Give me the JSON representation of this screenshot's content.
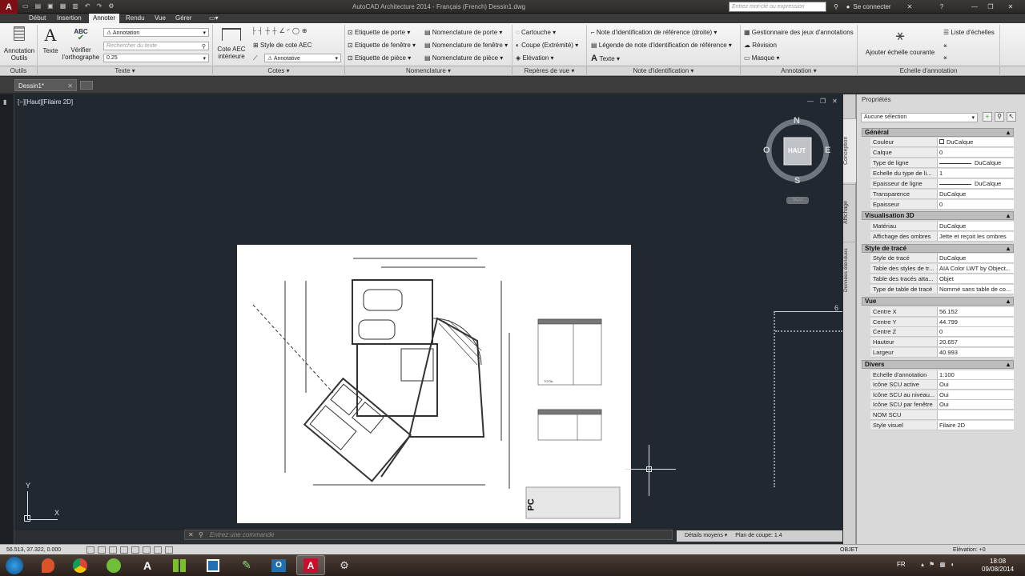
{
  "window": {
    "title": "AutoCAD Architecture 2014 - Français (French)    Dessin1.dwg",
    "search_placeholder": "Entrez mot-clé ou expression",
    "sign_in": "Se connecter"
  },
  "menu_tabs": [
    "Début",
    "Insertion",
    "Annoter",
    "Rendu",
    "Vue",
    "Gérer"
  ],
  "active_tab": "Annoter",
  "ribbon": {
    "outils": {
      "btn1_line1": "Annotation",
      "btn1_line2": "Outils",
      "panel": "Outils"
    },
    "texte": {
      "texte_btn": "Texte",
      "spell_top": "ABC",
      "spell_line1": "Vérifier",
      "spell_line2": "l'orthographe",
      "style_value": "Annotation",
      "search_placeholder": "Rechercher du texte",
      "height_value": "0.25",
      "panel": "Texte"
    },
    "cotes": {
      "cote_aec_line1": "Cote AEC",
      "cote_aec_line2": "intérieure",
      "style_label": "Style de cote AEC",
      "annotative": "Annotative",
      "panel": "Cotes"
    },
    "etiquettes": [
      "Etiquette de porte",
      "Etiquette de fenêtre",
      "Etiquette de pièce"
    ],
    "nomenclature": {
      "items": [
        "Nomenclature de porte",
        "Nomenclature de fenêtre",
        "Nomenclature de pièce"
      ],
      "panel": "Nomenclature"
    },
    "reperes": {
      "items": [
        "Cartouche",
        "Coupe (Extrémité)",
        "Elévation"
      ],
      "panel": "Repères de vue"
    },
    "note": {
      "items": [
        "Note d'identification de référence (droite)",
        "Légende de note d'identification de référence",
        "Texte"
      ],
      "panel": "Note d'identification"
    },
    "annotation": {
      "items": [
        "Gestionnaire des jeux d'annotations",
        "Révision",
        "Masque"
      ],
      "panel": "Annotation"
    },
    "echelle": {
      "add_line1": "Ajouter échelle courante",
      "list": "Liste d'échelles",
      "panel": "Echelle d'annotation"
    }
  },
  "doc_tab": "Dessin1*",
  "viewport_label": "[−][Haut][Filaire 2D]",
  "viewcube": {
    "n": "N",
    "s": "S",
    "e": "E",
    "o": "O",
    "face": "HAUT",
    "wcs": "SCU"
  },
  "command_placeholder": "Entrez une commande",
  "status": {
    "coords": "56.513, 37.322, 0.000",
    "details": "Détails moyens",
    "plan": "Plan de coupe: 1.4",
    "objet": "OBJET",
    "elevation": "Elévation: +0"
  },
  "properties": {
    "title": "Propriétés",
    "selection": "Aucune sélection",
    "vtabs": [
      "Conception",
      "Affichage",
      "Données étendues"
    ],
    "sections": [
      {
        "name": "Général",
        "rows": [
          [
            "Couleur",
            "DuCalque"
          ],
          [
            "Calque",
            "0"
          ],
          [
            "Type de ligne",
            "DuCalque"
          ],
          [
            "Echelle du type de li...",
            "1"
          ],
          [
            "Epaisseur de ligne",
            "DuCalque"
          ],
          [
            "Transparence",
            "DuCalque"
          ],
          [
            "Epaisseur",
            "0"
          ]
        ]
      },
      {
        "name": "Visualisation 3D",
        "rows": [
          [
            "Matériau",
            "DuCalque"
          ],
          [
            "Affichage des ombres",
            "Jette et reçoit les ombres"
          ]
        ]
      },
      {
        "name": "Style de tracé",
        "rows": [
          [
            "Style de tracé",
            "DuCalque"
          ],
          [
            "Table des styles de tr...",
            "AIA Color LWT by Object..."
          ],
          [
            "Table des tracés atta...",
            "Objet"
          ],
          [
            "Type de table de tracé",
            "Nommé sans table de co..."
          ]
        ]
      },
      {
        "name": "Vue",
        "rows": [
          [
            "Centre X",
            "56.152"
          ],
          [
            "Centre Y",
            "44.799"
          ],
          [
            "Centre Z",
            "0"
          ],
          [
            "Hauteur",
            "20.657"
          ],
          [
            "Largeur",
            "40.993"
          ]
        ]
      },
      {
        "name": "Divers",
        "rows": [
          [
            "Echelle d'annotation",
            "1:100"
          ],
          [
            "Icône SCU active",
            "Oui"
          ],
          [
            "Icône SCU au niveau...",
            "Oui"
          ],
          [
            "Icône SCU par fenêtre",
            "Oui"
          ],
          [
            "NOM SCU",
            ""
          ],
          [
            "Style visuel",
            "Filaire 2D"
          ]
        ]
      }
    ]
  },
  "taskbar": {
    "lang": "FR",
    "time": "18:08",
    "date": "09/08/2014"
  },
  "drawing": {
    "cartouche_pc": "PC",
    "table_total": "TOTAL",
    "edge_number": "6"
  },
  "colors": {
    "accent_red": "#c8102e",
    "ucs": "#dfe4ea"
  }
}
